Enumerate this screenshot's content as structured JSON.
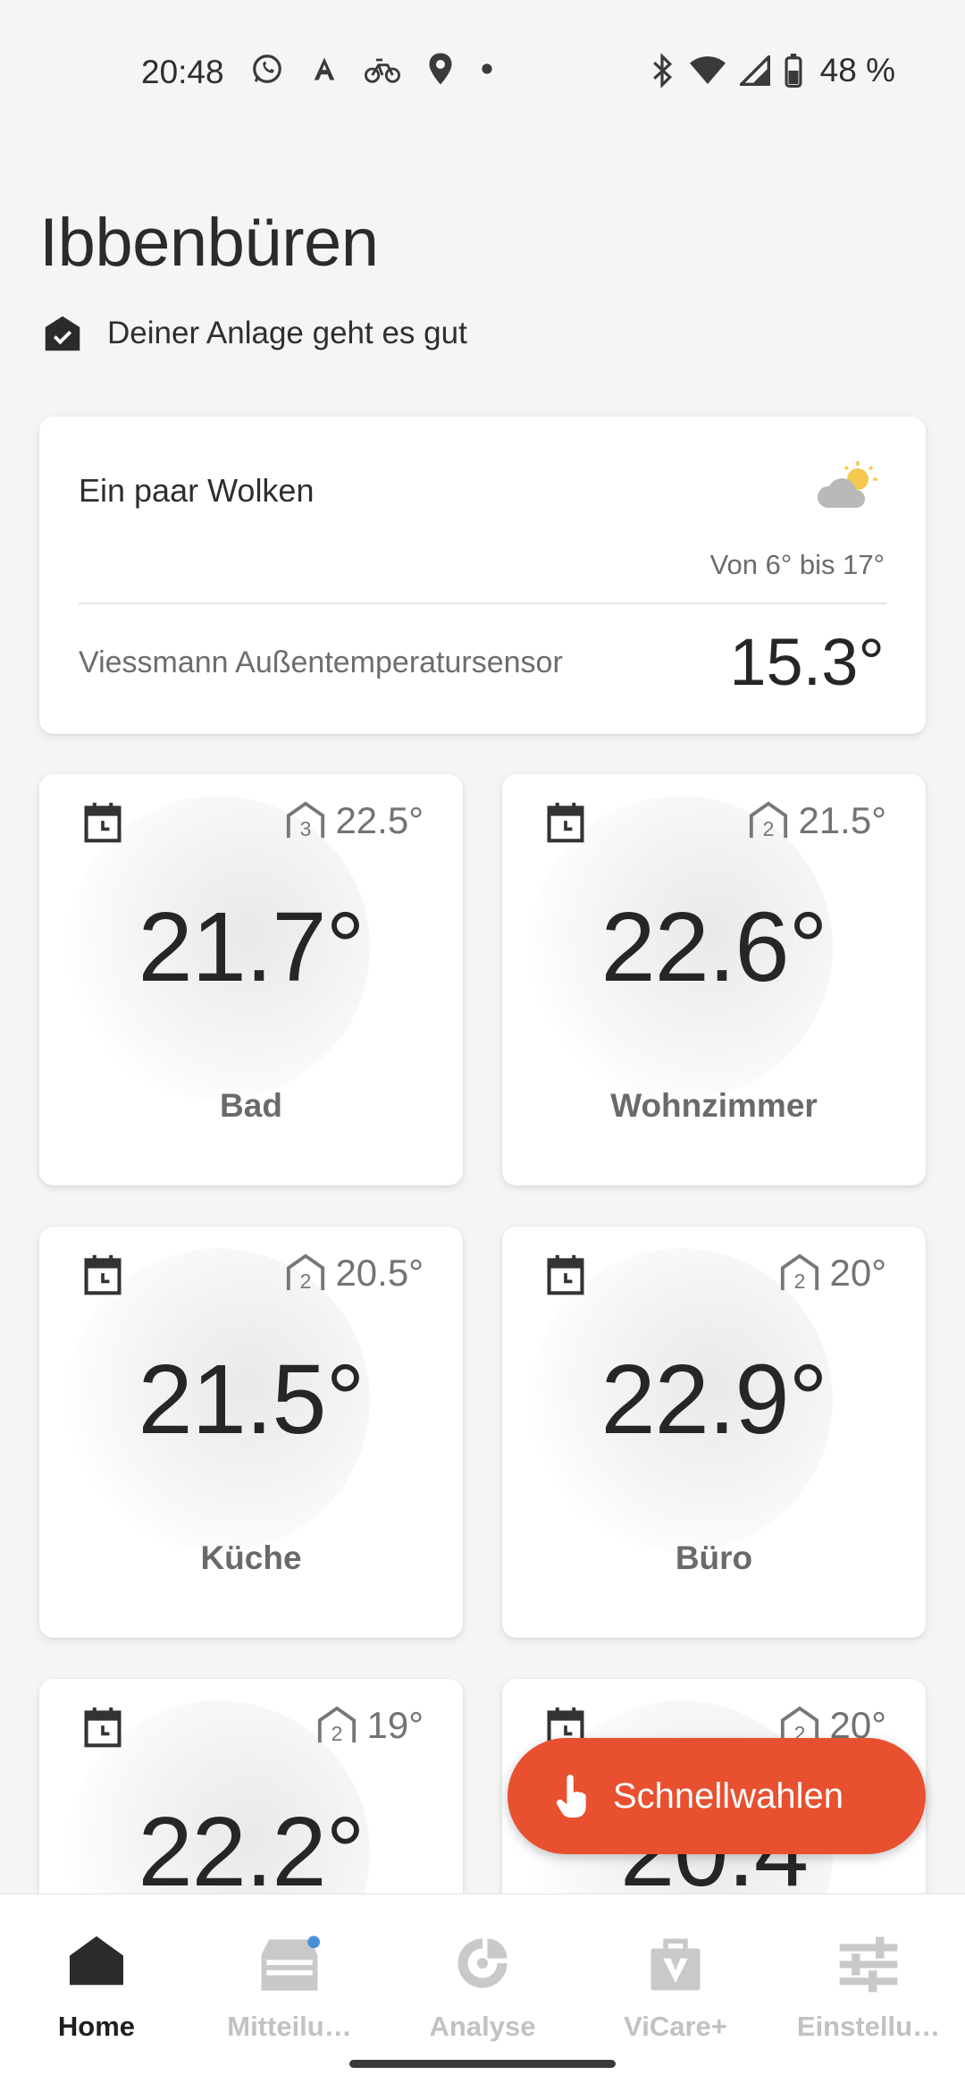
{
  "status_bar": {
    "time": "20:48",
    "left_icons": [
      "whatsapp-icon",
      "a-icon",
      "bike-icon",
      "location-icon",
      "dot-icon"
    ],
    "right_icons": [
      "bluetooth-icon",
      "wifi-icon",
      "signal-icon",
      "battery-icon"
    ],
    "battery": "48 %"
  },
  "header": {
    "title": "Ibbenbüren",
    "status_text": "Deiner Anlage geht es gut"
  },
  "weather": {
    "condition": "Ein paar Wolken",
    "icon": "partly-cloudy-icon",
    "range": "Von 6° bis 17°",
    "sensor_label": "Viessmann Außentemperatursensor",
    "sensor_temp": "15.3°"
  },
  "rooms": [
    {
      "name": "Bad",
      "current": "21.7°",
      "target": "22.5°",
      "level": "3"
    },
    {
      "name": "Wohnzimmer",
      "current": "22.6°",
      "target": "21.5°",
      "level": "2"
    },
    {
      "name": "Küche",
      "current": "21.5°",
      "target": "20.5°",
      "level": "2"
    },
    {
      "name": "Büro",
      "current": "22.9°",
      "target": "20°",
      "level": "2"
    },
    {
      "name": "",
      "current": "22.2°",
      "target": "19°",
      "level": "2"
    },
    {
      "name": "",
      "current": "20.4",
      "target": "20°",
      "level": "2"
    }
  ],
  "fab": {
    "label": "Schnellwahlen",
    "icon": "hand-pointer-icon"
  },
  "nav": [
    {
      "label": "Home",
      "icon": "home-icon",
      "active": true
    },
    {
      "label": "Mitteilu…",
      "icon": "inbox-icon",
      "active": false,
      "badge": true
    },
    {
      "label": "Analyse",
      "icon": "analysis-icon",
      "active": false
    },
    {
      "label": "ViCare+",
      "icon": "bag-v-icon",
      "active": false
    },
    {
      "label": "Einstellu…",
      "icon": "sliders-icon",
      "active": false
    }
  ],
  "colors": {
    "accent": "#e8502f",
    "background": "#f5f5f5",
    "badge": "#4a90d9",
    "nav_inactive": "#c2c2c2"
  }
}
